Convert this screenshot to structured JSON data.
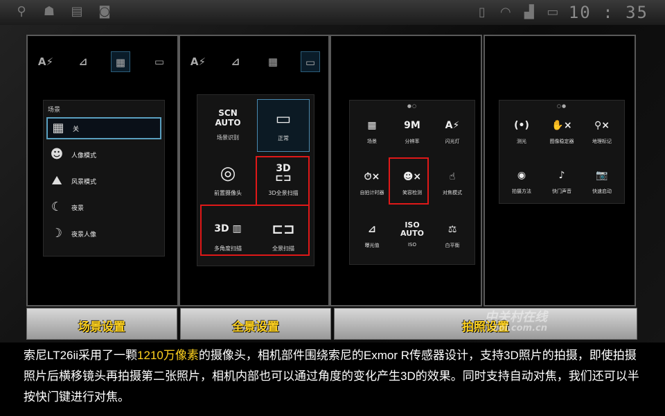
{
  "status_bar": {
    "left_icons": [
      "usb-icon",
      "android-icon",
      "sd-card-icon",
      "camera-app-icon"
    ],
    "right_icons": [
      "sim-icon",
      "wifi-icon",
      "signal-icon",
      "battery-icon"
    ],
    "time": "10 : 35"
  },
  "toolbar": {
    "flash": "A⚡",
    "exposure": "⊿",
    "scenes": "▦",
    "mode": "▭"
  },
  "scene_panel": {
    "title": "场景",
    "items": [
      {
        "icon": "grid-icon",
        "label": "关"
      },
      {
        "icon": "portrait-icon",
        "label": "人像模式"
      },
      {
        "icon": "landscape-icon",
        "label": "风景模式"
      },
      {
        "icon": "night-icon",
        "label": "夜景"
      },
      {
        "icon": "night-portrait-icon",
        "label": "夜景人像"
      }
    ]
  },
  "mode_panel": {
    "items": [
      {
        "icon": "SCN\nAUTO",
        "label": "场景识别"
      },
      {
        "icon": "▭",
        "label": "正常"
      },
      {
        "icon": "◎",
        "label": "前置摄像头"
      },
      {
        "icon": "3D ⊏⊐",
        "label": "3D全景扫描"
      },
      {
        "icon": "3D ▥",
        "label": "多角度扫描"
      },
      {
        "icon": "⊏⊐",
        "label": "全景扫描"
      }
    ]
  },
  "settings_page1": {
    "dots": "●○",
    "items": [
      {
        "icon": "▦",
        "label": "场景"
      },
      {
        "icon": "9M",
        "label": "分辨率"
      },
      {
        "icon": "A⚡",
        "label": "闪光灯"
      },
      {
        "icon": "⏱×",
        "label": "自拍计时器"
      },
      {
        "icon": "☻×",
        "label": "笑容检测"
      },
      {
        "icon": "☝",
        "label": "对焦模式"
      },
      {
        "icon": "⊿",
        "label": "曝光值"
      },
      {
        "icon": "ISO\nAUTO",
        "label": "ISO"
      },
      {
        "icon": "⚖",
        "label": "白平衡"
      }
    ]
  },
  "settings_page2": {
    "dots": "○●",
    "items": [
      {
        "icon": "(•)",
        "label": "测光"
      },
      {
        "icon": "✋×",
        "label": "图像稳定器"
      },
      {
        "icon": "⚲×",
        "label": "地理标记"
      },
      {
        "icon": "◉",
        "label": "拍摄方法"
      },
      {
        "icon": "♪",
        "label": "快门声音"
      },
      {
        "icon": "📷",
        "label": "快速启动"
      }
    ]
  },
  "captions": {
    "scene": "场景设置",
    "panorama": "全景设置",
    "shooting": "拍照设置"
  },
  "watermark": {
    "main": "中关村在线",
    "sub": "zol.com.cn"
  },
  "description": {
    "part1": "索尼LT26ii采用了一颗",
    "highlight": "1210万像素",
    "part2": "的摄像头，相机部件围绕索尼的Exmor R传感器设计，支持3D照片的拍摄，即使拍摄照片后横移镜头再拍摄第二张照片，相机内部也可以通过角度的变化产生3D的效果。同时支持自动对焦，我们还可以半按快门键进行对焦。"
  },
  "colors": {
    "caption_text": "#ffd21f",
    "highlight_frame": "#e01818",
    "selection": "#5aa0c0"
  }
}
